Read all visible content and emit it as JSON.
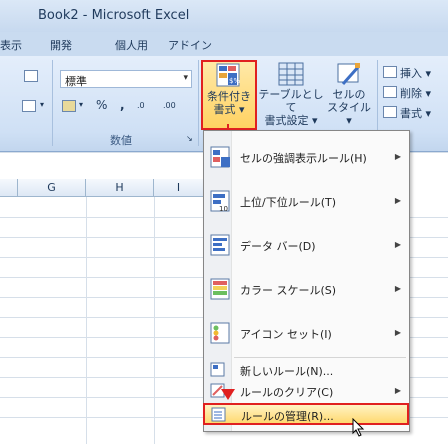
{
  "window": {
    "title": "Book2 - Microsoft Excel"
  },
  "tabs": [
    "表示",
    "開発",
    "個人用",
    "アドイン"
  ],
  "ribbon": {
    "number_format": "標準",
    "percent_symbol": "%",
    "comma_symbol": ",",
    "group_number_label": "数値",
    "conditional_formatting": {
      "line1": "条件付き",
      "line2": "書式 ▾"
    },
    "format_as_table": {
      "line1": "テーブルとして",
      "line2": "書式設定 ▾"
    },
    "cell_styles": {
      "line1": "セルの",
      "line2": "スタイル ▾"
    },
    "insert": "挿入 ▾",
    "delete": "削除 ▾",
    "format": "書式 ▾"
  },
  "sheet": {
    "columns": [
      "G",
      "H",
      "I"
    ]
  },
  "menu": {
    "items": [
      {
        "label": "セルの強調表示ルール(H)",
        "submenu": true
      },
      {
        "label": "上位/下位ルール(T)",
        "submenu": true
      },
      {
        "label": "データ バー(D)",
        "submenu": true
      },
      {
        "label": "カラー スケール(S)",
        "submenu": true
      },
      {
        "label": "アイコン セット(I)",
        "submenu": true
      },
      {
        "label": "新しいルール(N)...",
        "submenu": false
      },
      {
        "label": "ルールのクリア(C)",
        "submenu": true
      },
      {
        "label": "ルールの管理(R)...",
        "submenu": false,
        "highlighted": true
      }
    ]
  },
  "colors": {
    "highlight_border": "#e02020",
    "ribbon": "#cfe0f5"
  }
}
